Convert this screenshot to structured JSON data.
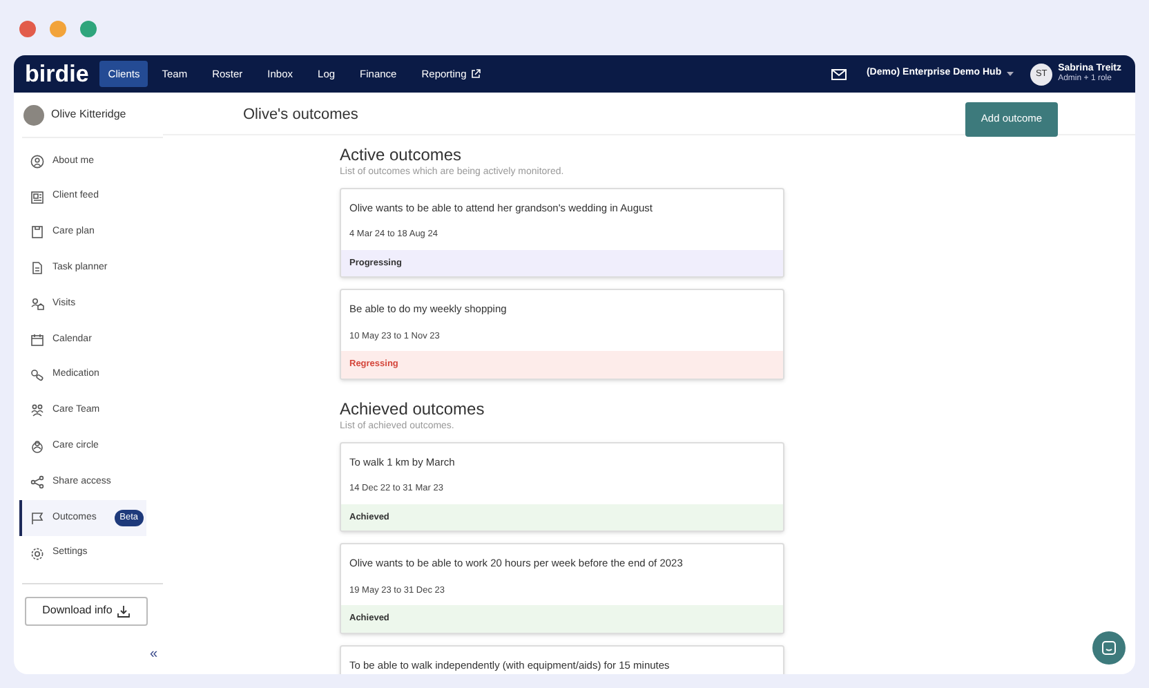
{
  "nav": {
    "logo": "birdie",
    "items": [
      {
        "label": "Clients",
        "selected": true
      },
      {
        "label": "Team",
        "selected": false
      },
      {
        "label": "Roster",
        "selected": false
      },
      {
        "label": "Inbox",
        "selected": false
      },
      {
        "label": "Log",
        "selected": false
      },
      {
        "label": "Finance",
        "selected": false
      },
      {
        "label": "Reporting",
        "selected": false,
        "external": true
      }
    ],
    "hub": "(Demo) Enterprise Demo Hub",
    "user": {
      "initials": "ST",
      "name": "Sabrina Treitz",
      "role": "Admin + 1 role"
    }
  },
  "client": {
    "name": "Olive Kitteridge"
  },
  "sidebar": {
    "items": [
      {
        "label": "About me",
        "selected": false
      },
      {
        "label": "Client feed",
        "selected": false
      },
      {
        "label": "Care plan",
        "selected": false
      },
      {
        "label": "Task planner",
        "selected": false
      },
      {
        "label": "Visits",
        "selected": false
      },
      {
        "label": "Calendar",
        "selected": false
      },
      {
        "label": "Medication",
        "selected": false
      },
      {
        "label": "Care Team",
        "selected": false
      },
      {
        "label": "Care circle",
        "selected": false
      },
      {
        "label": "Share access",
        "selected": false
      },
      {
        "label": "Outcomes",
        "selected": true,
        "badge": "Beta"
      },
      {
        "label": "Settings",
        "selected": false
      }
    ],
    "download": "Download info",
    "collapse": "«"
  },
  "page": {
    "title": "Olive's outcomes",
    "add_button": "Add outcome"
  },
  "sections": [
    {
      "title": "Active outcomes",
      "subtitle": "List of outcomes which are being actively monitored.",
      "outcomes": [
        {
          "title": "Olive wants to be able to attend her grandson's wedding in August",
          "dates": "4 Mar 24 to 18 Aug 24",
          "status": "Progressing",
          "kind": "progressing"
        },
        {
          "title": "Be able to do my weekly shopping",
          "dates": "10 May 23 to 1 Nov 23",
          "status": "Regressing",
          "kind": "regressing"
        }
      ]
    },
    {
      "title": "Achieved outcomes",
      "subtitle": "List of achieved outcomes.",
      "outcomes": [
        {
          "title": "To walk 1 km by March",
          "dates": "14 Dec 22 to 31 Mar 23",
          "status": "Achieved",
          "kind": "achieved"
        },
        {
          "title": "Olive wants to be able to work 20 hours per week before the end of 2023",
          "dates": "19 May 23 to 31 Dec 23",
          "status": "Achieved",
          "kind": "achieved"
        },
        {
          "title": "To be able to walk independently (with equipment/aids) for 15 minutes",
          "kind": "achieved"
        }
      ]
    }
  ]
}
